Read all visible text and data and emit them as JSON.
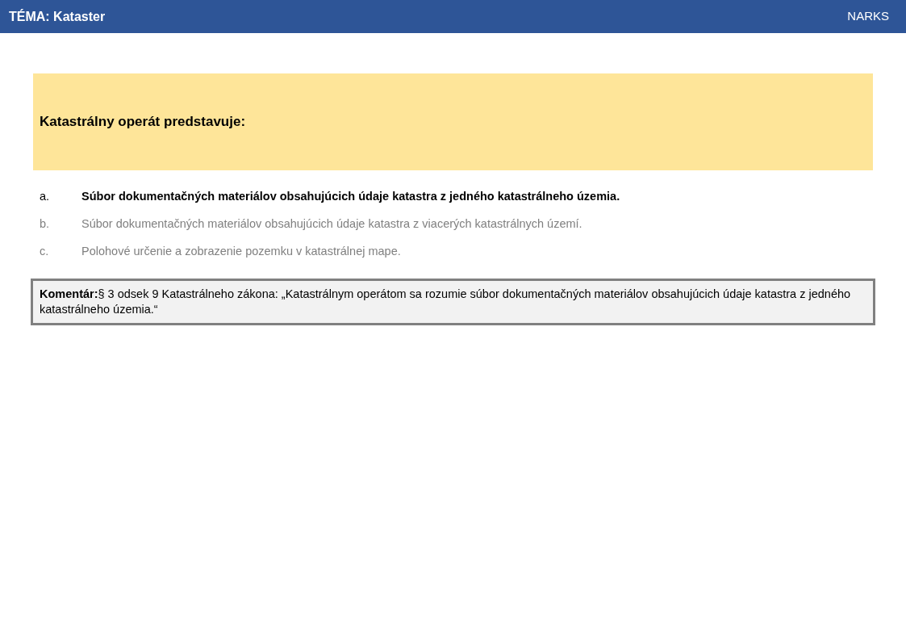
{
  "header": {
    "title": "TÉMA: Kataster",
    "brand": "NARKS"
  },
  "question": "Katastrálny operát predstavuje:",
  "answers": [
    {
      "letter": "a.",
      "text": "Súbor dokumentačných materiálov obsahujúcich údaje katastra z jedného katastrálneho územia.",
      "correct": true
    },
    {
      "letter": "b.",
      "text": "Súbor dokumentačných materiálov obsahujúcich údaje katastra z viacerých katastrálnych území.",
      "correct": false
    },
    {
      "letter": "c.",
      "text": "Polohové určenie a zobrazenie pozemku v katastrálnej mape.",
      "correct": false
    }
  ],
  "comment": "**Komentár:**§ 3 odsek 9 Katastrálneho zákona: „Katastrálnym operátom sa rozumie súbor dokumentačných materiálov obsahujúcich údaje katastra z jedného katastrálneho územia.“"
}
